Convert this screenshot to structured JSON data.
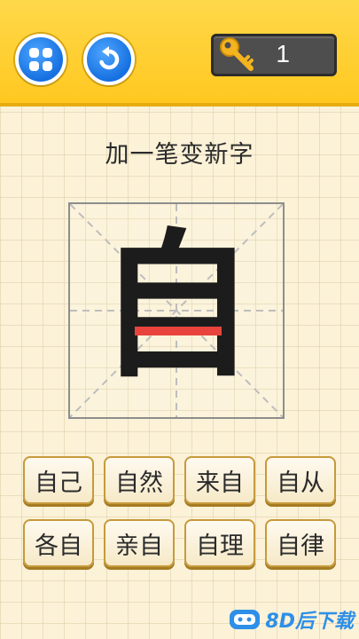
{
  "header": {
    "menu_icon": "grid-four-squares",
    "restart_icon": "circular-arrow",
    "key_icon": "golden-key",
    "key_count": "1"
  },
  "puzzle": {
    "title": "加一笔变新字",
    "character": "自",
    "hint_stroke_color": "#e8443d"
  },
  "answers": [
    "自己",
    "自然",
    "来自",
    "自从",
    "各自",
    "亲自",
    "自理",
    "自律"
  ],
  "watermark": {
    "text": "8D后下载"
  }
}
